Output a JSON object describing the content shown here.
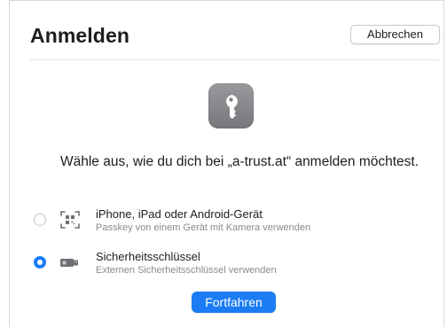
{
  "dialog": {
    "title": "Anmelden",
    "cancel_label": "Abbrechen",
    "prompt": "Wähle aus, wie du dich bei „a-trust.at“ anmelden möchtest.",
    "continue_label": "Fortfahren",
    "icon": "key-icon"
  },
  "options": [
    {
      "label": "iPhone, iPad oder Android-Gerät",
      "description": "Passkey von einem Gerät mit Kamera verwenden",
      "icon": "qr-code-icon",
      "selected": false
    },
    {
      "label": "Sicherheitsschlüssel",
      "description": "Externen Sicherheitsschlüssel verwenden",
      "icon": "security-key-icon",
      "selected": true
    }
  ],
  "colors": {
    "accent": "#1b7cf4",
    "key_tile": "#858589"
  }
}
